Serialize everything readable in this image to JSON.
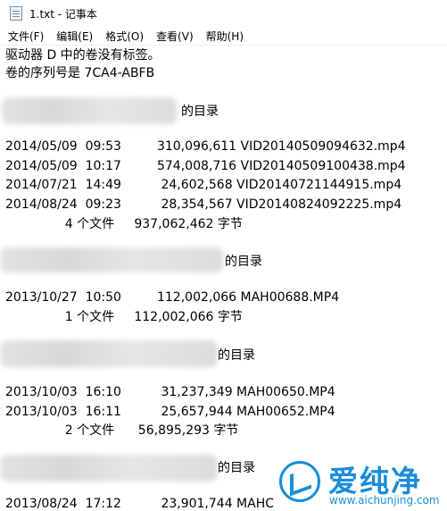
{
  "window": {
    "title": "1.txt - 记事本",
    "icon": "notepad-icon"
  },
  "menu": [
    {
      "label": "文件(F)"
    },
    {
      "label": "编辑(E)"
    },
    {
      "label": "格式(O)"
    },
    {
      "label": "查看(V)"
    },
    {
      "label": "帮助(H)"
    }
  ],
  "content": {
    "lines": [
      "驱动器 D 中的卷没有标签。",
      "卷的序列号是 7CA4-ABFB",
      "的目录",
      "2014/05/09  09:53         310,096,611 VID20140509094632.mp4",
      "2014/05/09  10:17         574,008,716 VID20140509100438.mp4",
      "2014/07/21  14:49          24,602,568 VID20140721144915.mp4",
      "2014/08/24  09:23          28,354,567 VID20140824092225.mp4",
      "               4 个文件     937,062,462 字节",
      "的目录",
      "2013/10/27  10:50         112,002,066 MAH00688.MP4",
      "               1 个文件     112,002,066 字节",
      "的目录",
      "2013/10/03  16:10          31,237,349 MAH00650.MP4",
      "2013/10/03  16:11          25,657,944 MAH00652.MP4",
      "               2 个文件      56,895,293 字节",
      "的目录",
      "2013/08/24  17:12          23,901,744 MAHC"
    ]
  },
  "watermark": {
    "brand": "爱纯净",
    "url": "www.aichunjing.com",
    "color": "#1a8dd8"
  }
}
